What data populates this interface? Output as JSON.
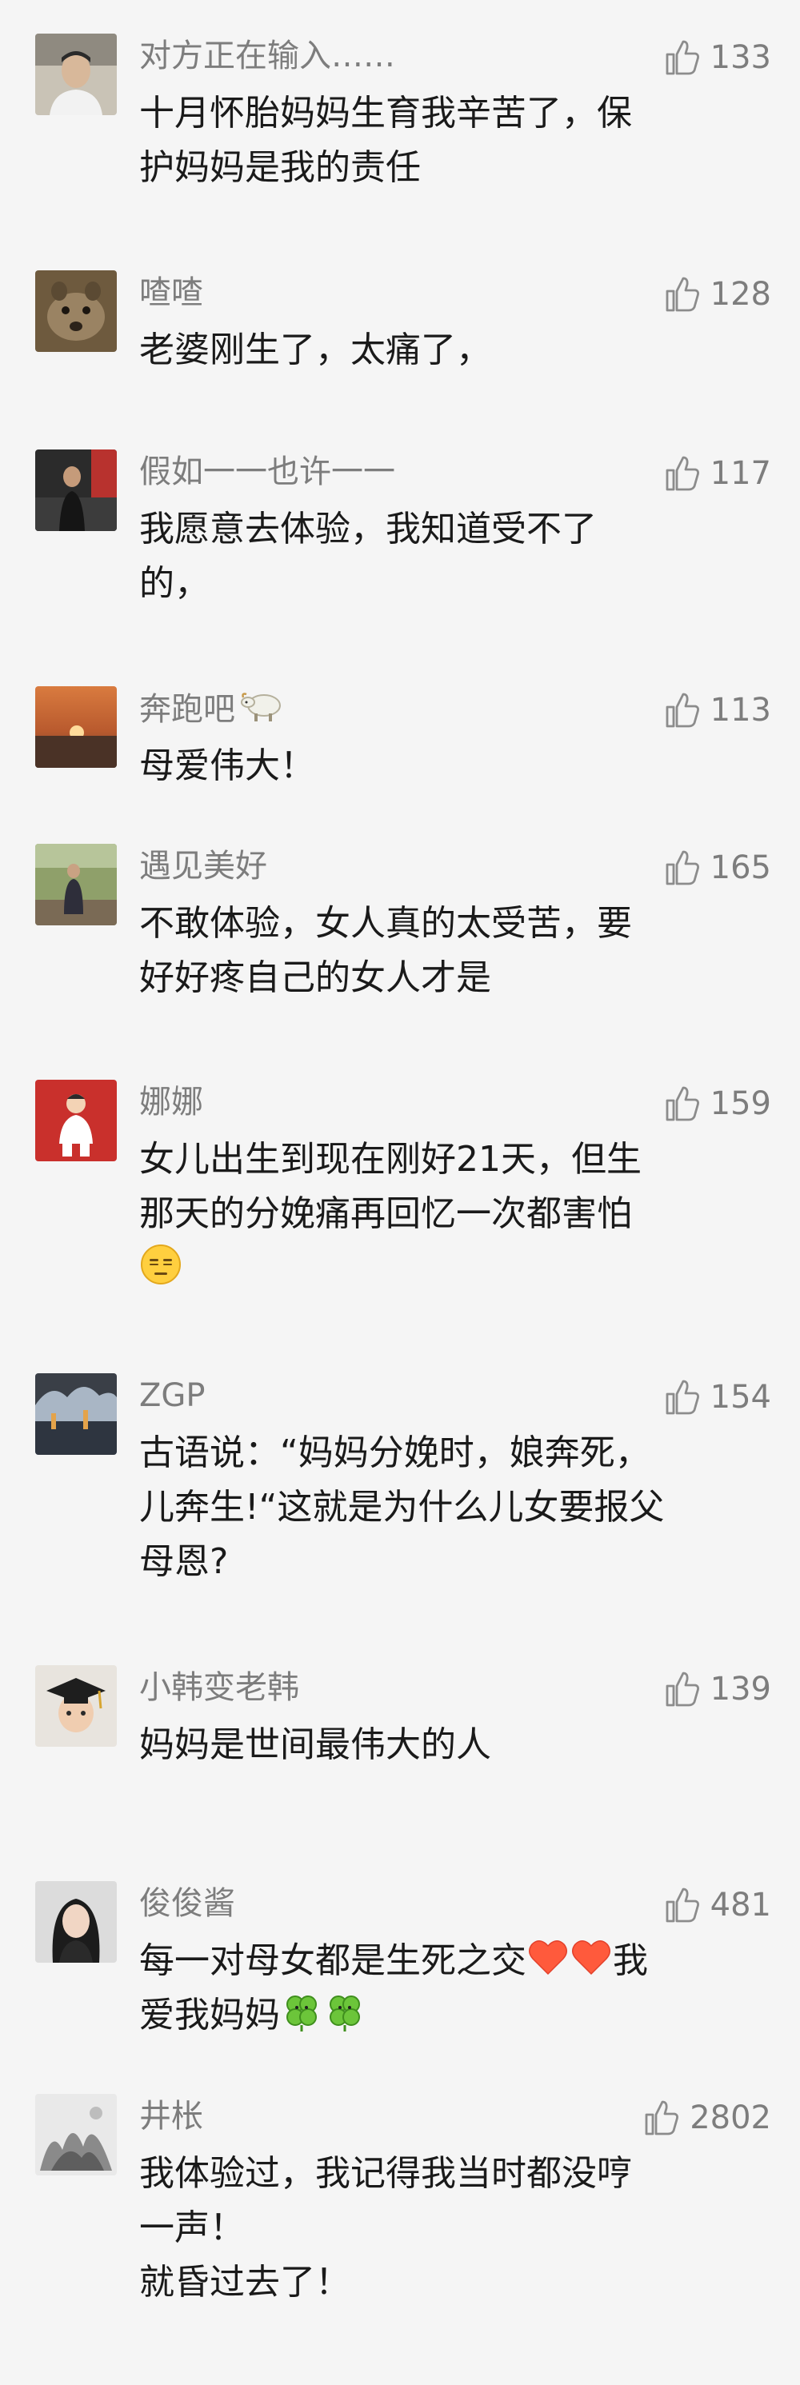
{
  "comments": [
    {
      "nickname": "对方正在输入……",
      "likes": "133",
      "lines": [
        "十月怀胎妈妈生育我辛苦了，保",
        "护妈妈是我的责任"
      ]
    },
    {
      "nickname": "喳喳",
      "likes": "128",
      "lines": [
        "老婆刚生了，太痛了，"
      ]
    },
    {
      "nickname": "假如一一也许一一",
      "likes": "117",
      "lines": [
        "我愿意去体验，我知道受不了",
        "的，"
      ]
    },
    {
      "nickname": "奔跑吧",
      "nickname_badge": "sheep-icon",
      "likes": "113",
      "lines": [
        "母爱伟大！"
      ]
    },
    {
      "nickname": "遇见美好",
      "likes": "165",
      "lines": [
        "不敢体验，女人真的太受苦，要",
        "好好疼自己的女人才是"
      ]
    },
    {
      "nickname": "娜娜",
      "likes": "159",
      "lines": [
        "女儿出生到现在刚好21天，但生",
        "那天的分娩痛再回忆一次都害怕"
      ],
      "trailing_emoji": "expressionless-face-icon"
    },
    {
      "nickname": "ZGP",
      "likes": "154",
      "lines": [
        "古语说：“妈妈分娩时，娘奔死，",
        "儿奔生!“这就是为什么儿女要报父",
        "母恩?"
      ]
    },
    {
      "nickname": "小韩变老韩",
      "likes": "139",
      "lines": [
        "妈妈是世间最伟大的人"
      ]
    },
    {
      "nickname": "俊俊酱",
      "likes": "481",
      "line1_before": "每一对母女都是生死之交",
      "line1_after": "我",
      "line2": "爱我妈妈",
      "emojis": [
        "heart-icon",
        "heart-icon",
        "clover-icon",
        "clover-icon"
      ]
    },
    {
      "nickname": "井枨",
      "likes": "2802",
      "lines": [
        "我体验过，我记得我当时都没哼",
        "一声！",
        "就昏过去了！"
      ]
    }
  ],
  "colors": {
    "background": "#f5f5f5",
    "nickname": "#7d7d7d",
    "text": "#1a1a1a",
    "heart": "#ff5a3c",
    "clover": "#6cc53a"
  }
}
